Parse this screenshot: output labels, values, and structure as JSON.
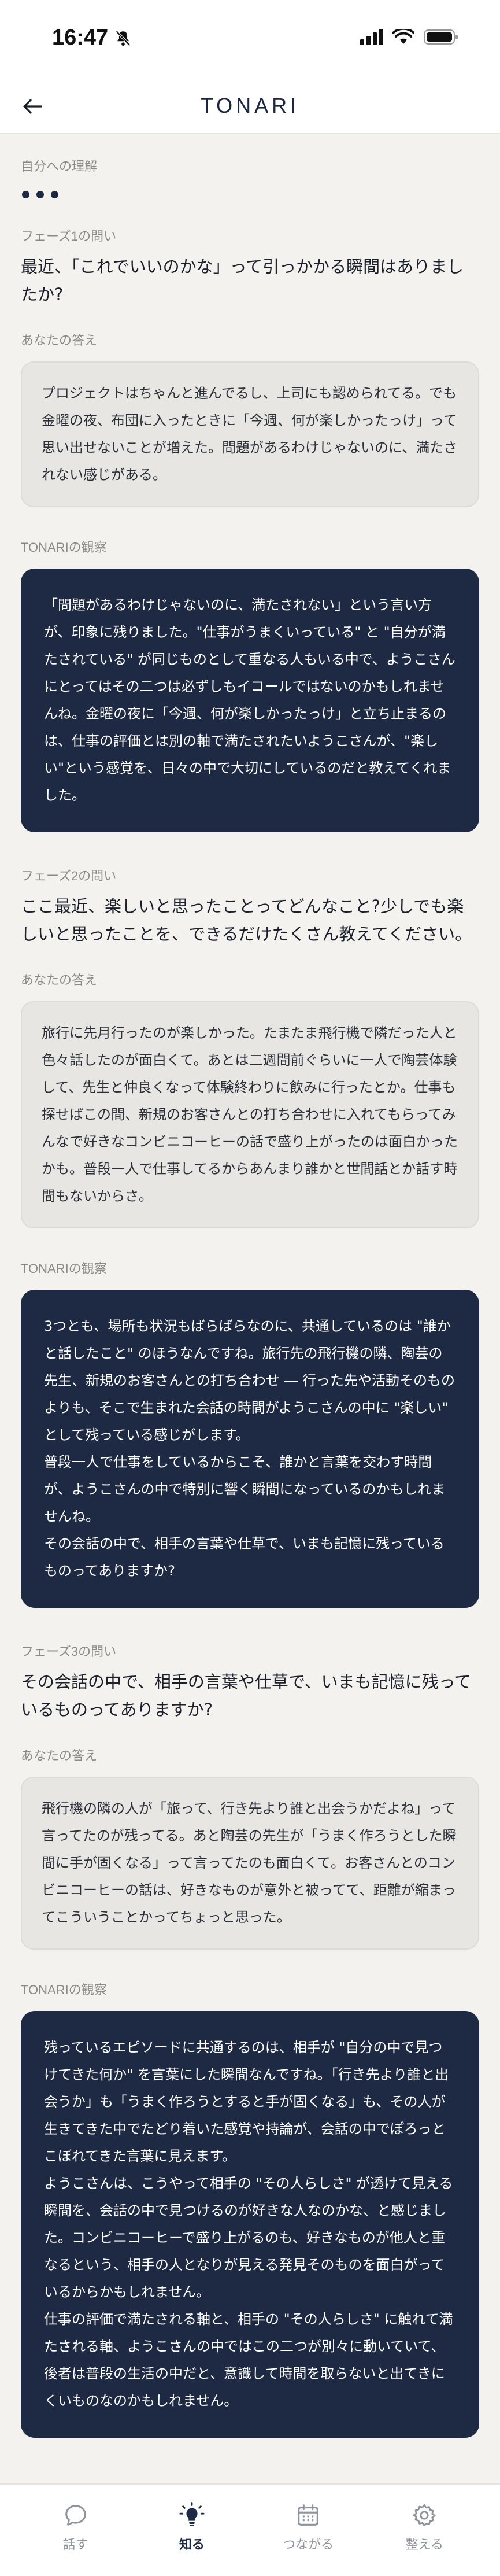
{
  "status": {
    "time": "16:47"
  },
  "header": {
    "title": "TONARI"
  },
  "section": {
    "label": "自分への理解"
  },
  "phases": [
    {
      "phase_label": "フェーズ1の問い",
      "question": "最近、「これでいいのかな」って引っかかる瞬間はありましたか?",
      "answer_label": "あなたの答え",
      "answer": "プロジェクトはちゃんと進んでるし、上司にも認められてる。でも金曜の夜、布団に入ったときに「今週、何が楽しかったっけ」って思い出せないことが増えた。問題があるわけじゃないのに、満たされない感じがある。",
      "obs_label": "TONARIの観察",
      "observation": [
        "「問題があるわけじゃないのに、満たされない」という言い方が、印象に残りました。\"仕事がうまくいっている\" と \"自分が満たされている\" が同じものとして重なる人もいる中で、ようこさんにとってはその二つは必ずしもイコールではないのかもしれませんね。金曜の夜に「今週、何が楽しかったっけ」と立ち止まるのは、仕事の評価とは別の軸で満たされたいようこさんが、\"楽しい\"という感覚を、日々の中で大切にしているのだと教えてくれました。"
      ]
    },
    {
      "phase_label": "フェーズ2の問い",
      "question": "ここ最近、楽しいと思ったことってどんなこと?少しでも楽しいと思ったことを、できるだけたくさん教えてください。",
      "answer_label": "あなたの答え",
      "answer": "旅行に先月行ったのが楽しかった。たまたま飛行機で隣だった人と色々話したのが面白くて。あとは二週間前ぐらいに一人で陶芸体験して、先生と仲良くなって体験終わりに飲みに行ったとか。仕事も探せばこの間、新規のお客さんとの打ち合わせに入れてもらってみんなで好きなコンビニコーヒーの話で盛り上がったのは面白かったかも。普段一人で仕事してるからあんまり誰かと世間話とか話す時間もないからさ。",
      "obs_label": "TONARIの観察",
      "observation": [
        "3つとも、場所も状況もばらばらなのに、共通しているのは \"誰かと話したこと\" のほうなんですね。旅行先の飛行機の隣、陶芸の先生、新規のお客さんとの打ち合わせ ― 行った先や活動そのものよりも、そこで生まれた会話の時間がようこさんの中に \"楽しい\" として残っている感じがします。",
        "普段一人で仕事をしているからこそ、誰かと言葉を交わす時間が、ようこさんの中で特別に響く瞬間になっているのかもしれませんね。",
        "その会話の中で、相手の言葉や仕草で、いまも記憶に残っているものってありますか?"
      ]
    },
    {
      "phase_label": "フェーズ3の問い",
      "question": "その会話の中で、相手の言葉や仕草で、いまも記憶に残っているものってありますか?",
      "answer_label": "あなたの答え",
      "answer": "飛行機の隣の人が「旅って、行き先より誰と出会うかだよね」って言ってたのが残ってる。あと陶芸の先生が「うまく作ろうとした瞬間に手が固くなる」って言ってたのも面白くて。お客さんとのコンビニコーヒーの話は、好きなものが意外と被ってて、距離が縮まってこういうことかってちょっと思った。",
      "obs_label": "TONARIの観察",
      "observation": [
        "残っているエピソードに共通するのは、相手が \"自分の中で見つけてきた何か\" を言葉にした瞬間なんですね。「行き先より誰と出会うか」も「うまく作ろうとすると手が固くなる」も、その人が生きてきた中でたどり着いた感覚や持論が、会話の中でぽろっとこぼれてきた言葉に見えます。",
        "ようこさんは、こうやって相手の \"その人らしさ\" が透けて見える瞬間を、会話の中で見つけるのが好きな人なのかな、と感じました。コンビニコーヒーで盛り上がるのも、好きなものが他人と重なるという、相手の人となりが見える発見そのものを面白がっているからかもしれません。",
        "仕事の評価で満たされる軸と、相手の \"その人らしさ\" に触れて満たされる軸、ようこさんの中ではこの二つが別々に動いていて、後者は普段の生活の中だと、意識して時間を取らないと出てきにくいものなのかもしれません。"
      ]
    }
  ],
  "tabbar": {
    "tabs": [
      {
        "label": "話す",
        "icon": "chat-bubble-icon",
        "active": false
      },
      {
        "label": "知る",
        "icon": "lightbulb-icon",
        "active": true
      },
      {
        "label": "つながる",
        "icon": "calendar-icon",
        "active": false
      },
      {
        "label": "整える",
        "icon": "gear-icon",
        "active": false
      }
    ]
  },
  "colors": {
    "accent": "#1e2a44",
    "background": "#f3f2ef",
    "card": "#e7e6e3"
  }
}
